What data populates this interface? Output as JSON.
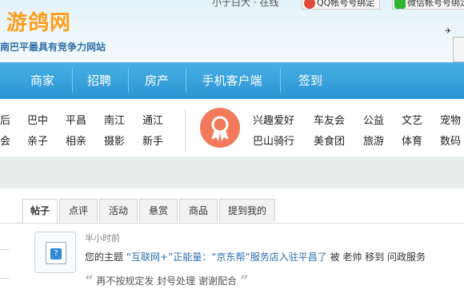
{
  "header": {
    "logo": "游鸽网",
    "slogan": "南巴平最具有竞争力网站",
    "top_links": "小于白大 · 在线",
    "qq_login": "QQ帐号号绑定",
    "wechat_login": "微信帐号号绑定"
  },
  "nav": [
    "商家",
    "招聘",
    "房产",
    "手机客户端",
    "签到"
  ],
  "cats_left": {
    "row1": [
      "后",
      "巴中",
      "平昌",
      "南江",
      "通江"
    ],
    "row2": [
      "会",
      "亲子",
      "相亲",
      "摄影",
      "新手"
    ]
  },
  "cats_right": {
    "row1": [
      "兴趣爱好",
      "车友会",
      "公益",
      "文艺",
      "宠物"
    ],
    "row2": [
      "巴山骑行",
      "美食团",
      "旅游",
      "体育",
      "数码"
    ]
  },
  "tabs": [
    "帖子",
    "点评",
    "活动",
    "悬赏",
    "商品",
    "提到我的"
  ],
  "post": {
    "time": "半小时前",
    "prefix": "您的主题",
    "topic": "“互联网+”正能量：“京东帮”服务店入驻平昌了",
    "suffix": "被 老帅 移到 问政服务",
    "note": "再不按规定发 封号处理 谢谢配合",
    "open_quote": "“",
    "close_quote": "”"
  },
  "colors": {
    "nav": "#2a94d2",
    "logo": "#ff9c1a",
    "badge": "#f07a5b",
    "link": "#2a6fb2"
  }
}
